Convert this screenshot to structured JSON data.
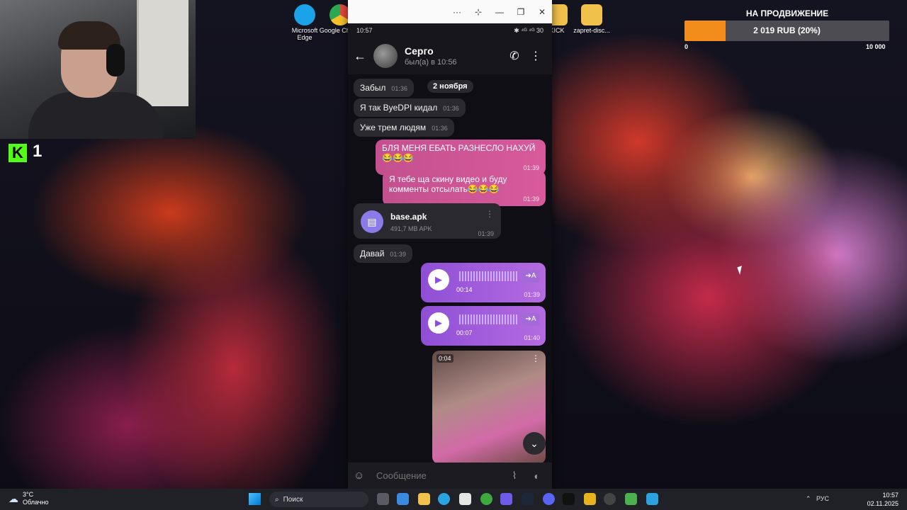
{
  "desktop": {
    "icons": [
      {
        "label": "Microsoft Edge",
        "icon": "edge-icon",
        "color": "#1aa3e8"
      },
      {
        "label": "Google Chrom",
        "icon": "chrome-icon",
        "color": "#e8453c"
      },
      {
        "label": "KICK",
        "icon": "folder-icon",
        "color": "#f0c14b"
      },
      {
        "label": "zapret-disc...",
        "icon": "folder-icon",
        "color": "#f0c14b"
      }
    ]
  },
  "stream": {
    "kick_logo": "K",
    "viewer_count": "1"
  },
  "promo": {
    "title": "НА ПРОДВИЖЕНИЕ",
    "progress_text": "2 019 RUB (20%)",
    "progress": 0.2019,
    "min_label": "0",
    "max_label": "10 000",
    "colors": {
      "fill": "#f28c1a",
      "track": "#4c4c52"
    }
  },
  "window": {
    "controls": [
      "···",
      "⊹",
      "—",
      "❐",
      "✕"
    ]
  },
  "phone": {
    "status_time": "10:57",
    "status_right": "✱ ⁴ᴳ ⁴ᴳ 30"
  },
  "chat": {
    "contact_name": "Серго",
    "contact_status": "был(а) в 10:56",
    "date_chip": "2 ноября",
    "incoming": [
      {
        "text": "Забыл",
        "time": "01:36"
      },
      {
        "text": "Я так ByeDPI кидал",
        "time": "01:36"
      },
      {
        "text": "Уже трем людям",
        "time": "01:36"
      }
    ],
    "outgoing": [
      {
        "text": "БЛЯ МЕНЯ ЕБАТЬ РАЗНЕСЛО НАХУЙ 😂😂😂",
        "time": "01:39"
      },
      {
        "text": "Я тебе ща скину видео и буду комменты отсылать😂😂😂",
        "time": "01:39"
      }
    ],
    "file": {
      "name": "base.apk",
      "size": "491,7 MB APK",
      "time": "01:39"
    },
    "reply": {
      "text": "Давай",
      "time": "01:39"
    },
    "voices": [
      {
        "duration": "00:14",
        "time": "01:39",
        "translate": "➔A"
      },
      {
        "duration": "00:07",
        "time": "01:40",
        "translate": "➔A"
      }
    ],
    "video": {
      "duration": "0:04"
    },
    "composer_placeholder": "Сообщение",
    "colors": {
      "outgoing": "#d85a9c",
      "voice": "#8f4fd6",
      "file_icon": "#8b7be8"
    }
  },
  "taskbar": {
    "temperature": "3°C",
    "weather": "Облачно",
    "search_placeholder": "Поиск",
    "language": "РУС",
    "time": "10:57",
    "date": "02.11.2025"
  }
}
